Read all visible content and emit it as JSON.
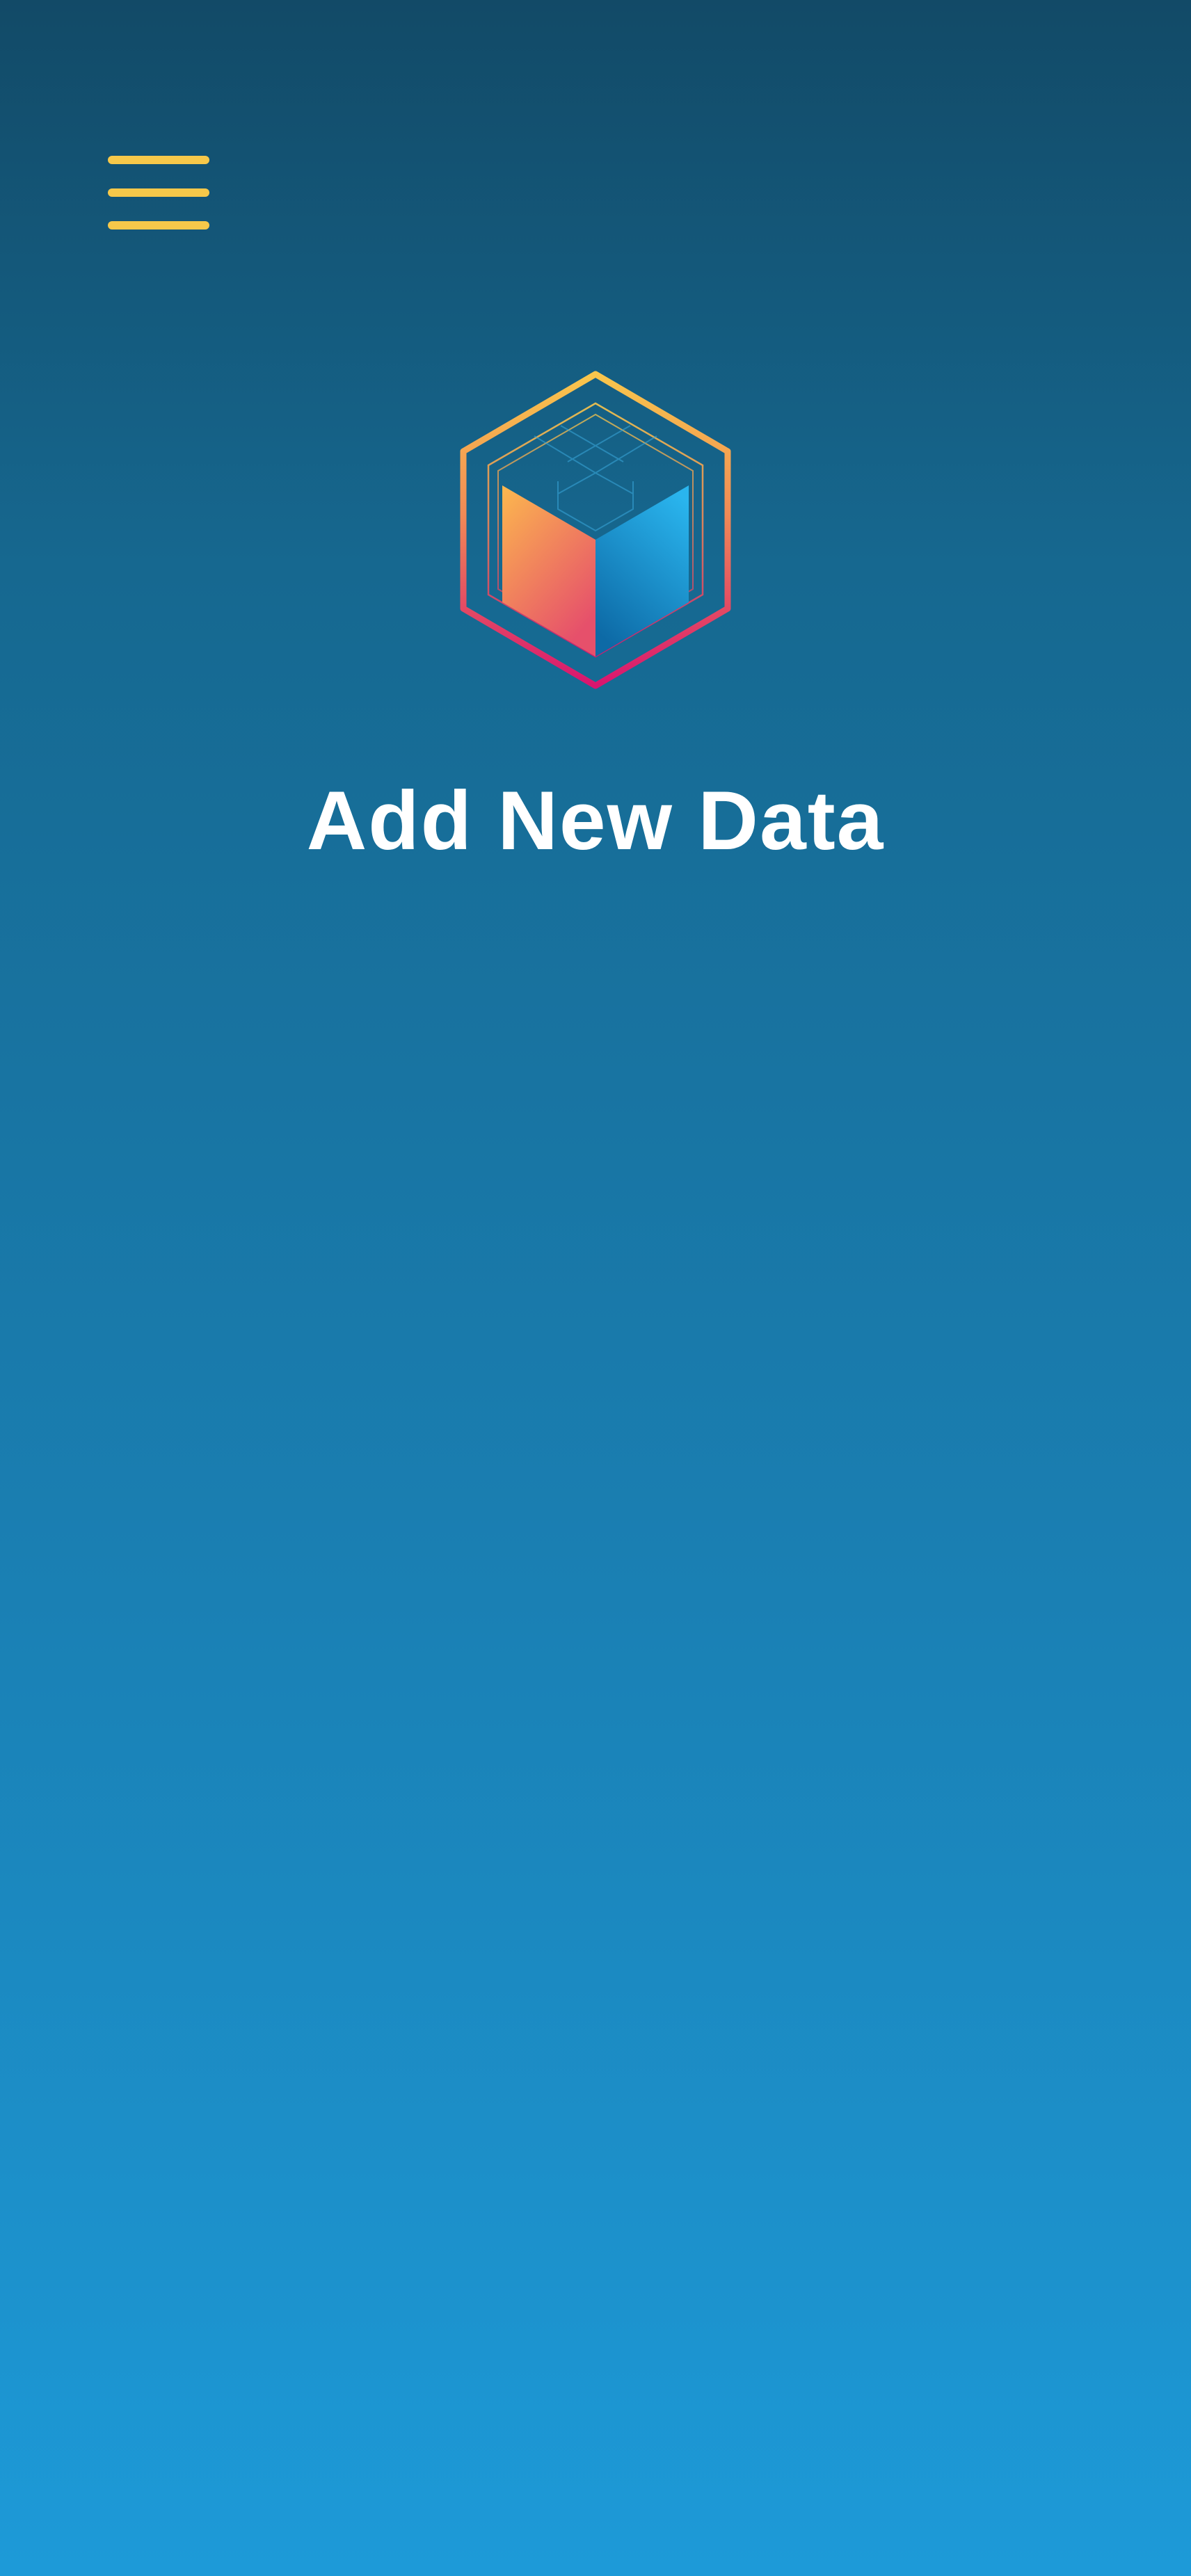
{
  "header": {
    "menu_icon": "hamburger-menu-icon",
    "menu_color": "#f6c84a"
  },
  "logo": {
    "icon": "cube-in-hexagon-icon",
    "colors": {
      "hexagon_top": "#f8c64c",
      "hexagon_bottom": "#d8156f",
      "cube_left_top": "#fcb84e",
      "cube_left_bottom": "#e6506b",
      "cube_right_top": "#2ab5ee",
      "cube_right_bottom": "#0d6aa6"
    }
  },
  "main": {
    "title": "Add New Data"
  },
  "theme": {
    "background_top": "#124a67",
    "background_bottom": "#1d9ad8",
    "text": "#ffffff"
  }
}
